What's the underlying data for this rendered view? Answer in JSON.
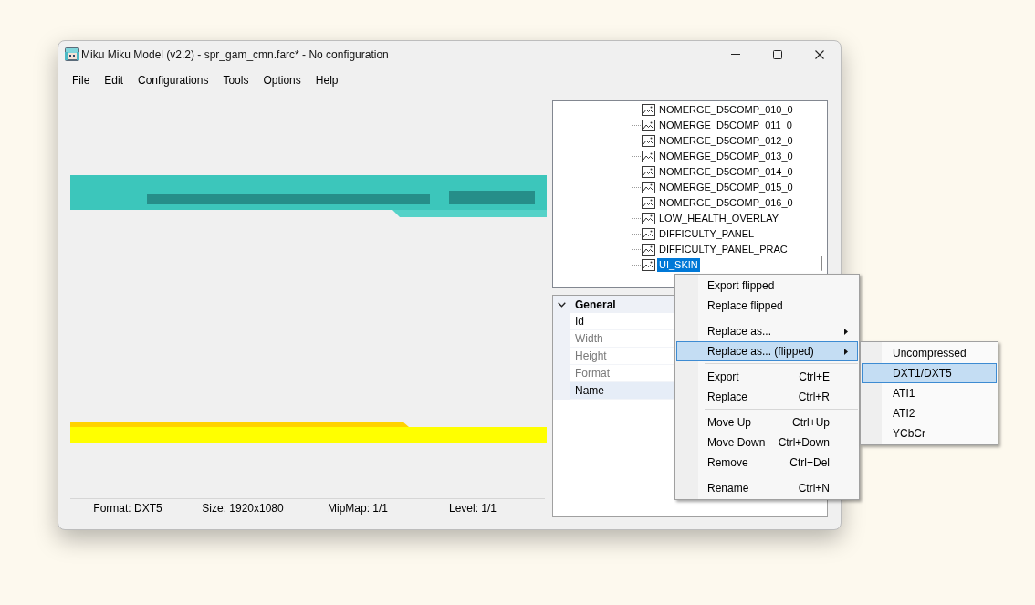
{
  "window": {
    "title": "Miku Miku Model (v2.2) - spr_gam_cmn.farc* - No configuration"
  },
  "menu_bar": [
    "File",
    "Edit",
    "Configurations",
    "Tools",
    "Options",
    "Help"
  ],
  "status_bar": [
    "Format: DXT5",
    "Size: 1920x1080",
    "MipMap: 1/1",
    "Level: 1/1"
  ],
  "tree": {
    "items": [
      {
        "label": "NOMERGE_D5COMP_010_0",
        "selected": false
      },
      {
        "label": "NOMERGE_D5COMP_011_0",
        "selected": false
      },
      {
        "label": "NOMERGE_D5COMP_012_0",
        "selected": false
      },
      {
        "label": "NOMERGE_D5COMP_013_0",
        "selected": false
      },
      {
        "label": "NOMERGE_D5COMP_014_0",
        "selected": false
      },
      {
        "label": "NOMERGE_D5COMP_015_0",
        "selected": false
      },
      {
        "label": "NOMERGE_D5COMP_016_0",
        "selected": false
      },
      {
        "label": "LOW_HEALTH_OVERLAY",
        "selected": false
      },
      {
        "label": "DIFFICULTY_PANEL",
        "selected": false
      },
      {
        "label": "DIFFICULTY_PANEL_PRAC",
        "selected": false
      },
      {
        "label": "UI_SKIN",
        "selected": true
      }
    ]
  },
  "properties": {
    "category": {
      "label": "General",
      "expanded": true
    },
    "rows": [
      {
        "label": "Id",
        "readonly": false,
        "selected": false
      },
      {
        "label": "Width",
        "readonly": true,
        "selected": false
      },
      {
        "label": "Height",
        "readonly": true,
        "selected": false
      },
      {
        "label": "Format",
        "readonly": true,
        "selected": false
      },
      {
        "label": "Name",
        "readonly": false,
        "selected": true
      }
    ]
  },
  "context_menu": {
    "items": [
      {
        "kind": "item",
        "label": "Export flipped",
        "has_submenu": false,
        "selected": false
      },
      {
        "kind": "item",
        "label": "Replace flipped",
        "has_submenu": false,
        "selected": false
      },
      {
        "kind": "separator"
      },
      {
        "kind": "item",
        "label": "Replace as...",
        "has_submenu": true,
        "selected": false
      },
      {
        "kind": "item",
        "label": "Replace as... (flipped)",
        "has_submenu": true,
        "selected": true,
        "submenu": [
          {
            "label": "Uncompressed",
            "selected": false
          },
          {
            "label": "DXT1/DXT5",
            "selected": true
          },
          {
            "label": "ATI1",
            "selected": false
          },
          {
            "label": "ATI2",
            "selected": false
          },
          {
            "label": "YCbCr",
            "selected": false
          }
        ]
      },
      {
        "kind": "separator"
      },
      {
        "kind": "item",
        "label": "Export",
        "shortcut": "Ctrl+E",
        "has_submenu": false,
        "selected": false
      },
      {
        "kind": "item",
        "label": "Replace",
        "shortcut": "Ctrl+R",
        "has_submenu": false,
        "selected": false
      },
      {
        "kind": "separator"
      },
      {
        "kind": "item",
        "label": "Move Up",
        "shortcut": "Ctrl+Up",
        "has_submenu": false,
        "selected": false
      },
      {
        "kind": "item",
        "label": "Move Down",
        "shortcut": "Ctrl+Down",
        "has_submenu": false,
        "selected": false
      },
      {
        "kind": "item",
        "label": "Remove",
        "shortcut": "Ctrl+Del",
        "has_submenu": false,
        "selected": false
      },
      {
        "kind": "separator"
      },
      {
        "kind": "item",
        "label": "Rename",
        "shortcut": "Ctrl+N",
        "has_submenu": false,
        "selected": false
      }
    ]
  }
}
